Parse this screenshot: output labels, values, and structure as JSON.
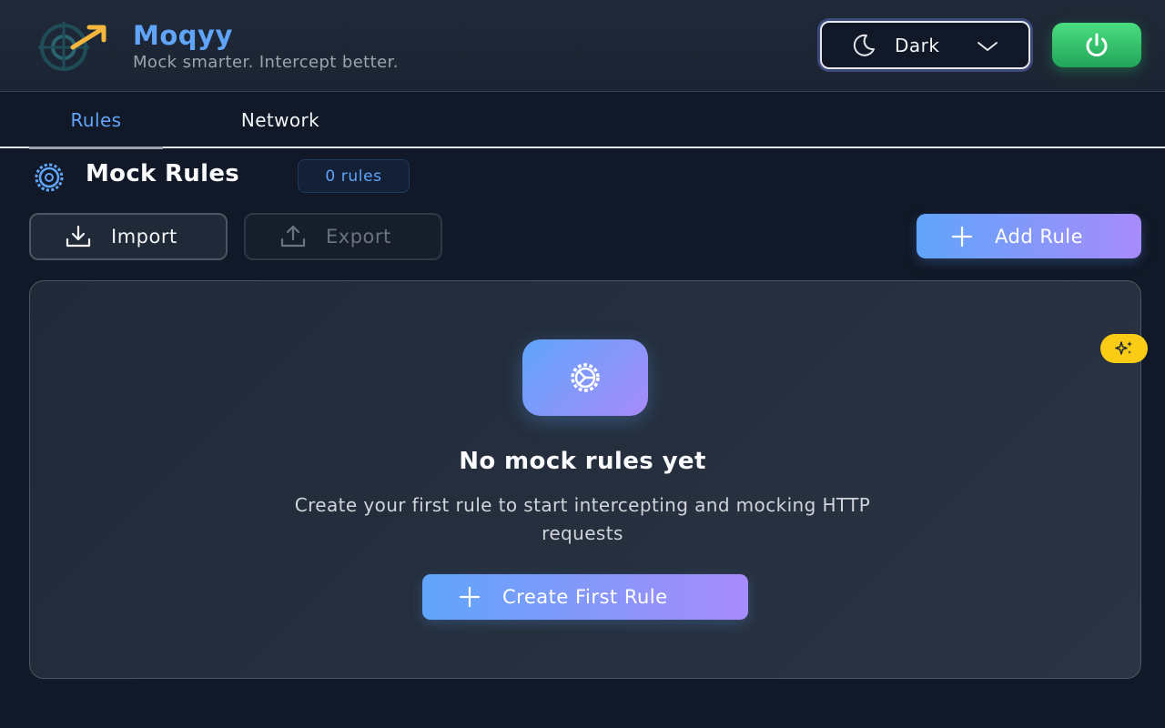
{
  "app": {
    "name": "Moqyy",
    "tagline": "Mock smarter. Intercept better."
  },
  "header": {
    "theme_label": "Dark",
    "theme_icon": "moon-icon",
    "power_icon": "power-icon"
  },
  "tabs": [
    {
      "label": "Rules",
      "active": true
    },
    {
      "label": "Network",
      "active": false
    }
  ],
  "section": {
    "title": "Mock Rules",
    "count_badge": "0 rules"
  },
  "toolbar": {
    "import_label": "Import",
    "export_label": "Export",
    "add_label": "Add Rule"
  },
  "empty_state": {
    "title": "No mock rules yet",
    "description": "Create your first rule to start intercepting and mocking HTTP requests",
    "button_label": "Create First Rule"
  },
  "colors": {
    "accent": "#60a5fa",
    "gradient_end": "#a78bfa",
    "power_green": "#22c55e",
    "sparkle_yellow": "#facc15"
  }
}
